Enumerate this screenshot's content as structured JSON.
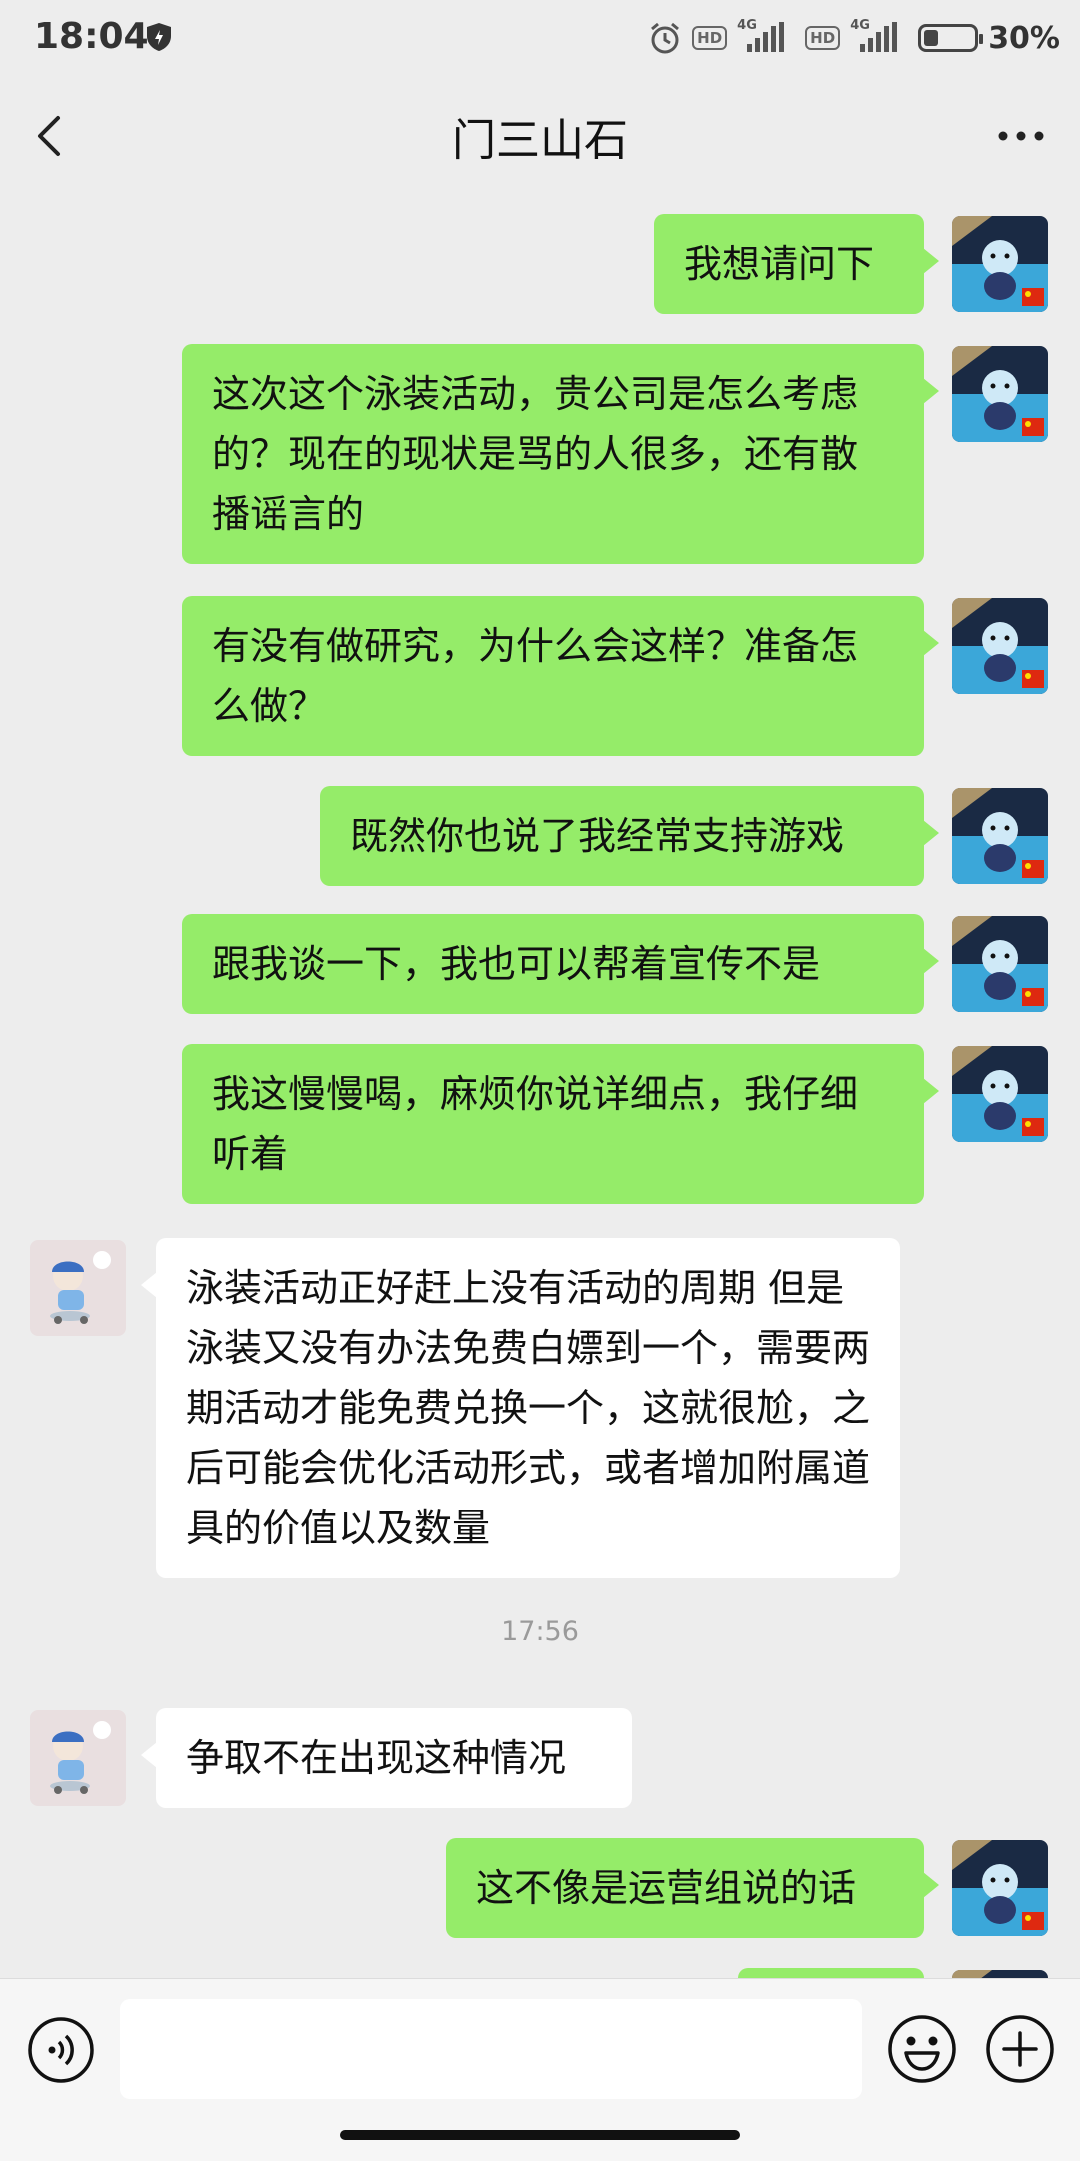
{
  "status_bar": {
    "time": "18:04",
    "hd1": "HD",
    "net1": "4G",
    "hd2": "HD",
    "net2": "4G",
    "battery_level": 0.3,
    "battery_percent": "30%"
  },
  "header": {
    "title": "门三山石",
    "back_icon": "chevron-left-icon",
    "more_icon": "more-dots-icon"
  },
  "messages": [
    {
      "sender": "me",
      "text": "我想请问下"
    },
    {
      "sender": "me",
      "text": "这次这个泳装活动，贵公司是怎么考虑的？现在的现状是骂的人很多，还有散播谣言的"
    },
    {
      "sender": "me",
      "text": "有没有做研究，为什么会这样？准备怎么做？"
    },
    {
      "sender": "me",
      "text": "既然你也说了我经常支持游戏"
    },
    {
      "sender": "me",
      "text": "跟我谈一下，我也可以帮着宣传不是"
    },
    {
      "sender": "me",
      "text": "我这慢慢喝，麻烦你说详细点，我仔细听着"
    },
    {
      "sender": "them",
      "text": "泳装活动正好赶上没有活动的周期 但是泳装又没有办法免费白嫖到一个，需要两期活动才能免费兑换一个，这就很尬，之后可能会优化活动形式，或者增加附属道具的价值以及数量"
    },
    {
      "timestamp": "17:56"
    },
    {
      "sender": "them",
      "text": "争取不在出现这种情况"
    },
    {
      "sender": "me",
      "text": "这不像是运营组说的话"
    }
  ],
  "input": {
    "value": "",
    "voice_icon": "voice-icon",
    "emoji_icon": "emoji-icon",
    "plus_icon": "plus-icon"
  },
  "colors": {
    "background": "#ededed",
    "my_bubble": "#95ec69",
    "their_bubble": "#ffffff",
    "timestamp": "#9a9a9a"
  }
}
